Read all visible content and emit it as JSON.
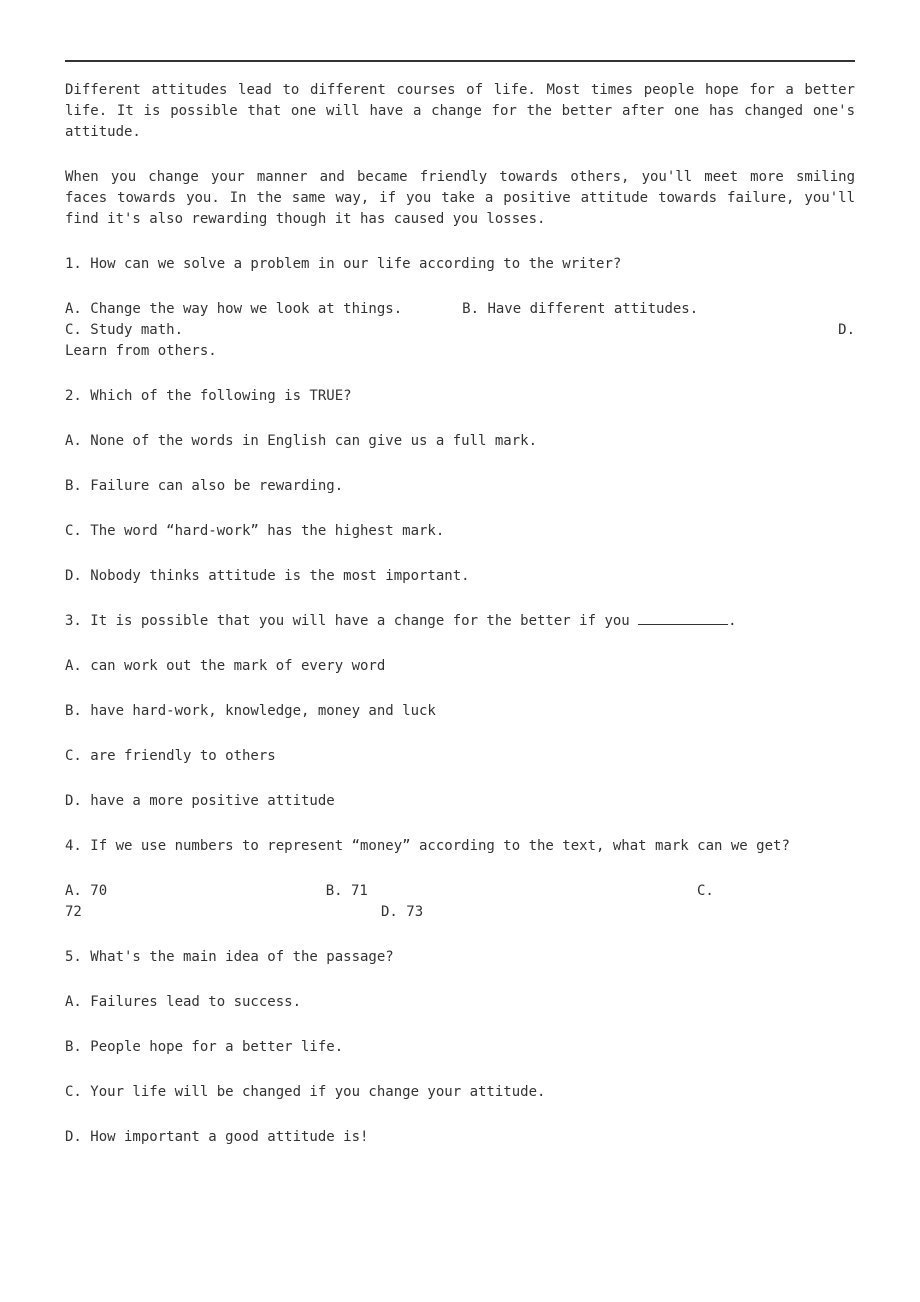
{
  "passage": {
    "p1": "Different attitudes lead to different courses of life. Most times people hope for a better life. It is possible that one will have a change for the better after one has changed one's attitude.",
    "p2": "When you change your manner and became friendly towards others, you'll meet more smiling faces towards you. In the same way, if you take a positive attitude towards failure, you'll find it's also rewarding though it has caused you losses."
  },
  "questions": [
    {
      "stem": "1. How can we solve a problem in our life according to the writer?",
      "options": {
        "A": "A. Change the way how we look at things.",
        "B": "B. Have different attitudes.",
        "C": "C. Study math.",
        "D_prefix": "D.",
        "D_suffix": "Learn from others."
      }
    },
    {
      "stem": "2. Which of the following is TRUE?",
      "options": {
        "A": "A. None of the words in English can give us a full mark.",
        "B": "B. Failure can also be rewarding.",
        "C": "C. The word “hard-work” has the highest mark.",
        "D": "D. Nobody thinks attitude is the most important."
      }
    },
    {
      "stem_prefix": "3. It is possible that you will have a change for the better if you ",
      "stem_suffix": ".",
      "options": {
        "A": "A. can work out the mark of every word",
        "B": "B. have hard-work, knowledge, money and luck",
        "C": "C. are friendly to others",
        "D": "D. have a more positive attitude"
      }
    },
    {
      "stem": "4. If we use numbers to represent “money” according to the text, what mark can we get?",
      "options": {
        "A": "A. 70",
        "B": "B. 71",
        "C_prefix": "C.",
        "C_suffix": "72",
        "D": "D. 73"
      }
    },
    {
      "stem": "5. What's the main idea of the passage?",
      "options": {
        "A": "A. Failures lead to success.",
        "B": "B. People hope for a better life.",
        "C": "C. Your life will be changed if you change your attitude.",
        "D": "D. How important a good attitude is!"
      }
    }
  ]
}
